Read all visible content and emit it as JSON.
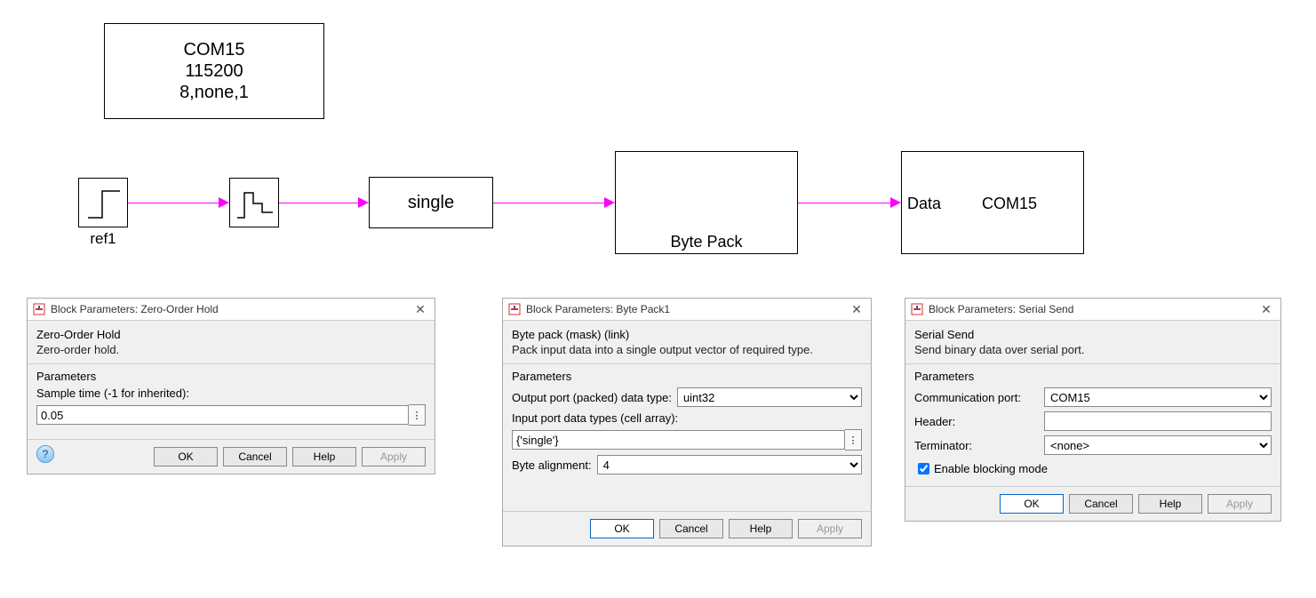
{
  "diagram": {
    "serial_cfg": {
      "line1": "COM15",
      "line2": "115200",
      "line3": "8,none,1"
    },
    "step": {
      "label": "ref1"
    },
    "convert": {
      "text": "single"
    },
    "bytepack": {
      "label": "Byte Pack"
    },
    "send": {
      "port_label": "Data",
      "text": "COM15"
    }
  },
  "dlg_zoh": {
    "title": "Block Parameters: Zero-Order Hold",
    "heading": "Zero-Order Hold",
    "desc": "Zero-order hold.",
    "params_title": "Parameters",
    "sample_time_label": "Sample time (-1 for inherited):",
    "sample_time_value": "0.05",
    "buttons": {
      "ok": "OK",
      "cancel": "Cancel",
      "help": "Help",
      "apply": "Apply"
    }
  },
  "dlg_bp": {
    "title": "Block Parameters: Byte Pack1",
    "heading": "Byte pack (mask) (link)",
    "desc": "Pack input data into a single output vector of required type.",
    "params_title": "Parameters",
    "out_type_label": "Output port (packed) data type:",
    "out_type_value": "uint32",
    "in_types_label": "Input port data types (cell array):",
    "in_types_value": "{'single'}",
    "align_label": "Byte alignment:",
    "align_value": "4",
    "buttons": {
      "ok": "OK",
      "cancel": "Cancel",
      "help": "Help",
      "apply": "Apply"
    }
  },
  "dlg_ss": {
    "title": "Block Parameters: Serial Send",
    "heading": "Serial Send",
    "desc": "Send binary data over serial port.",
    "params_title": "Parameters",
    "comm_label": "Communication port:",
    "comm_value": "COM15",
    "header_label": "Header:",
    "header_value": "",
    "term_label": "Terminator:",
    "term_value": "<none>",
    "blocking_label": "Enable blocking mode",
    "buttons": {
      "ok": "OK",
      "cancel": "Cancel",
      "help": "Help",
      "apply": "Apply"
    }
  }
}
